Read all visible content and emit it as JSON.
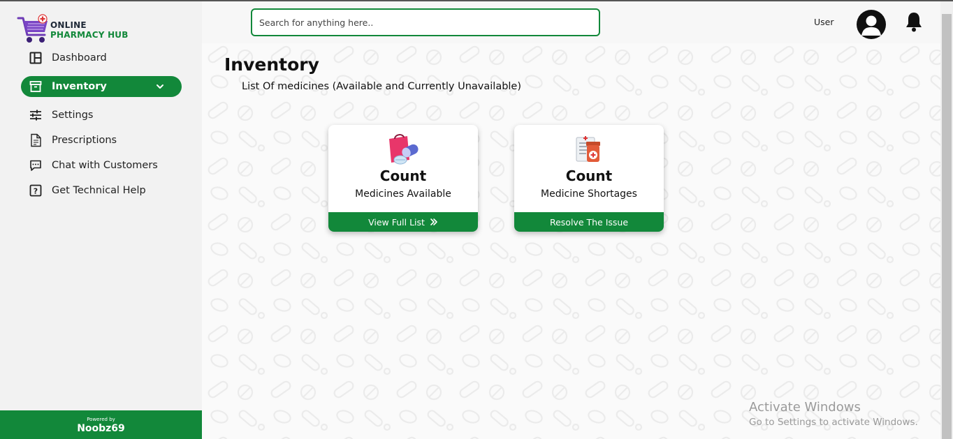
{
  "brand": {
    "line1": "ONLINE",
    "line2": "PHARMACY HUB",
    "accent": "#12883a"
  },
  "sidebar": {
    "items": [
      {
        "label": "Dashboard",
        "icon": "dashboard-icon",
        "active": false
      },
      {
        "label": "Inventory",
        "icon": "inventory-icon",
        "active": true
      },
      {
        "label": "Settings",
        "icon": "sliders-icon",
        "active": false
      },
      {
        "label": "Prescriptions",
        "icon": "document-icon",
        "active": false
      },
      {
        "label": "Chat with Customers",
        "icon": "chat-icon",
        "active": false
      },
      {
        "label": "Get Technical Help",
        "icon": "help-icon",
        "active": false
      }
    ],
    "footer": {
      "powered_by": "Powered by",
      "name": "Noobz69"
    }
  },
  "header": {
    "search_placeholder": "Search for anything here..",
    "user_label": "User"
  },
  "main": {
    "title": "Inventory",
    "subtitle": "List Of medicines (Available and Currently Unavailable)",
    "cards": [
      {
        "count": "Count",
        "label": "Medicines Available",
        "action": "View Full List",
        "icon": "medicine-bag-icon"
      },
      {
        "count": "Count",
        "label": "Medicine Shortages",
        "action": "Resolve The Issue",
        "icon": "medicine-report-icon"
      }
    ]
  },
  "watermark": {
    "title": "Activate Windows",
    "subtitle": "Go to Settings to activate Windows."
  }
}
